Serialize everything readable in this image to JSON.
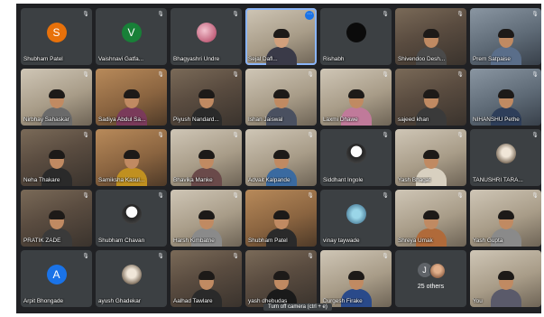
{
  "participants": [
    {
      "name": "Shubham Patel",
      "type": "initial",
      "initial": "S",
      "color": "#e8710a"
    },
    {
      "name": "Vaishnavi Gatfa...",
      "type": "initial",
      "initial": "V",
      "color": "#188038"
    },
    {
      "name": "Bhagyashri Undre",
      "type": "image"
    },
    {
      "name": "Sejal Dafl...",
      "type": "video",
      "highlight": true,
      "more": true
    },
    {
      "name": "Rishabh",
      "type": "dark"
    },
    {
      "name": "Shivendoo Desh...",
      "type": "video"
    },
    {
      "name": "Prem Satpaise",
      "type": "video"
    },
    {
      "name": "Nirbhay Sahaskar",
      "type": "video"
    },
    {
      "name": "Sadiya Abdul Sa...",
      "type": "video"
    },
    {
      "name": "Piyush Nandard...",
      "type": "video"
    },
    {
      "name": "Ishan Jaiswal",
      "type": "video"
    },
    {
      "name": "Laxmi Dhawe",
      "type": "video"
    },
    {
      "name": "sajeed khan",
      "type": "video"
    },
    {
      "name": "NIHANSHU Pethe",
      "type": "video"
    },
    {
      "name": "Neha Thakare",
      "type": "video"
    },
    {
      "name": "Samiksha Kasul...",
      "type": "video"
    },
    {
      "name": "Bhavika Manke",
      "type": "video"
    },
    {
      "name": "Advait Kalpande",
      "type": "video"
    },
    {
      "name": "Siddhant Ingole",
      "type": "image"
    },
    {
      "name": "Yash Bhagat",
      "type": "video"
    },
    {
      "name": "TANUSHRI TARA...",
      "type": "image"
    },
    {
      "name": "PRATIK ZADE",
      "type": "video"
    },
    {
      "name": "Shubham Chavan",
      "type": "image"
    },
    {
      "name": "Harsh Kimbatne",
      "type": "video"
    },
    {
      "name": "Shubham Patel",
      "type": "video"
    },
    {
      "name": "vinay taywade",
      "type": "image"
    },
    {
      "name": "Shreya Umak",
      "type": "video"
    },
    {
      "name": "Yash Gupta",
      "type": "video"
    },
    {
      "name": "Arpit Bhongade",
      "type": "initial",
      "initial": "A",
      "color": "#1a73e8"
    },
    {
      "name": "ayush Ghadekar",
      "type": "image"
    },
    {
      "name": "Aalhad Tawlare",
      "type": "video"
    },
    {
      "name": "yash dhebudas",
      "type": "video"
    },
    {
      "name": "Durgesh Firake",
      "type": "video"
    },
    {
      "name": "25 others",
      "type": "others",
      "initial": "J"
    },
    {
      "name": "You",
      "type": "video"
    }
  ],
  "icons": {
    "mic_muted": "mic-off-icon",
    "more_options": "more-options-icon"
  },
  "tooltip": "Turn off camera (ctrl + e)"
}
